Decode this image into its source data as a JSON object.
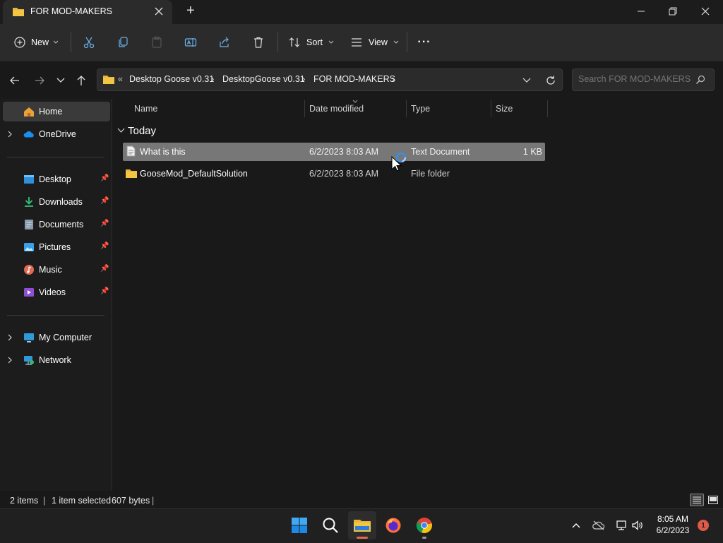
{
  "window": {
    "tab_title": "FOR MOD-MAKERS",
    "new_tab_symbol": "+"
  },
  "toolbar": {
    "new_label": "New",
    "sort_label": "Sort",
    "view_label": "View",
    "more_label": "···"
  },
  "address": {
    "overflow_symbol": "«",
    "crumbs": [
      "Desktop Goose v0.31",
      "DesktopGoose v0.31",
      "FOR MOD-MAKERS"
    ],
    "separator": "›"
  },
  "search": {
    "placeholder": "Search FOR MOD-MAKERS"
  },
  "sidebar": {
    "home": "Home",
    "onedrive": "OneDrive",
    "quick": [
      {
        "label": "Desktop",
        "icon": "desktop-icon"
      },
      {
        "label": "Downloads",
        "icon": "downloads-icon"
      },
      {
        "label": "Documents",
        "icon": "documents-icon"
      },
      {
        "label": "Pictures",
        "icon": "pictures-icon"
      },
      {
        "label": "Music",
        "icon": "music-icon"
      },
      {
        "label": "Videos",
        "icon": "videos-icon"
      }
    ],
    "my_computer": "My Computer",
    "network": "Network"
  },
  "columns": {
    "name": "Name",
    "date": "Date modified",
    "type": "Type",
    "size": "Size"
  },
  "group": {
    "label": "Today"
  },
  "files": [
    {
      "name": "What is this",
      "date": "6/2/2023 8:03 AM",
      "type": "Text Document",
      "size": "1 KB",
      "selected": true
    },
    {
      "name": "GooseMod_DefaultSolution",
      "date": "6/2/2023 8:03 AM",
      "type": "File folder",
      "size": "",
      "selected": false
    }
  ],
  "status": {
    "items": "2 items",
    "selected": "1 item selected",
    "bytes": "607 bytes",
    "divider": "|"
  },
  "taskbar": {
    "time": "8:05 AM",
    "date": "6/2/2023",
    "notification_count": "1"
  },
  "colors": {
    "background": "#191919",
    "toolbar": "#2b2b2b",
    "selection": "#777777",
    "folder": "#f4c542",
    "accent": "#0078d4"
  }
}
